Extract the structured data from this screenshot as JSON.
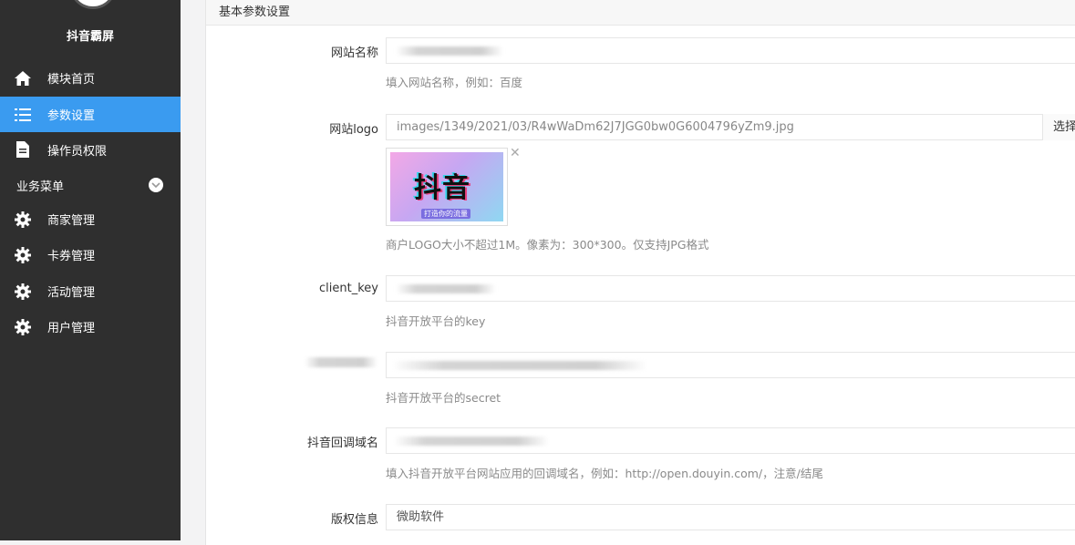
{
  "sidebar": {
    "brand": "抖音霸屏",
    "items": [
      {
        "label": "模块首页",
        "icon": "home-icon"
      },
      {
        "label": "参数设置",
        "icon": "list-icon",
        "active": true
      },
      {
        "label": "操作员权限",
        "icon": "document-icon"
      }
    ],
    "group_title": "业务菜单",
    "group_items": [
      {
        "label": "商家管理",
        "icon": "gear-icon"
      },
      {
        "label": "卡券管理",
        "icon": "gear-icon"
      },
      {
        "label": "活动管理",
        "icon": "gear-icon"
      },
      {
        "label": "用户管理",
        "icon": "gear-icon"
      }
    ],
    "active_color": "#3a9bf0"
  },
  "panel": {
    "title": "基本参数设置",
    "fields": {
      "site_name": {
        "label": "网站名称",
        "value": "",
        "help": "填入网站名称，例如：百度"
      },
      "site_logo": {
        "label": "网站logo",
        "value": "images/1349/2021/03/R4wWaDm62J7JGG0bw0G6004796yZm9.jpg",
        "button": "选择",
        "thumb_text": "抖音",
        "thumb_sub": "打造你的流量",
        "help": "商户LOGO大小不超过1M。像素为：300*300。仅支持JPG格式"
      },
      "client_key": {
        "label": "client_key",
        "value": "",
        "help": "抖音开放平台的key"
      },
      "client_secret": {
        "label": "",
        "value": "",
        "help": "抖音开放平台的secret"
      },
      "callback_domain": {
        "label": "抖音回调域名",
        "value": "",
        "help": "填入抖音开放平台网站应用的回调域名，例如：http://open.douyin.com/，注意/结尾"
      },
      "copyright": {
        "label": "版权信息",
        "value": "微助软件"
      }
    }
  }
}
